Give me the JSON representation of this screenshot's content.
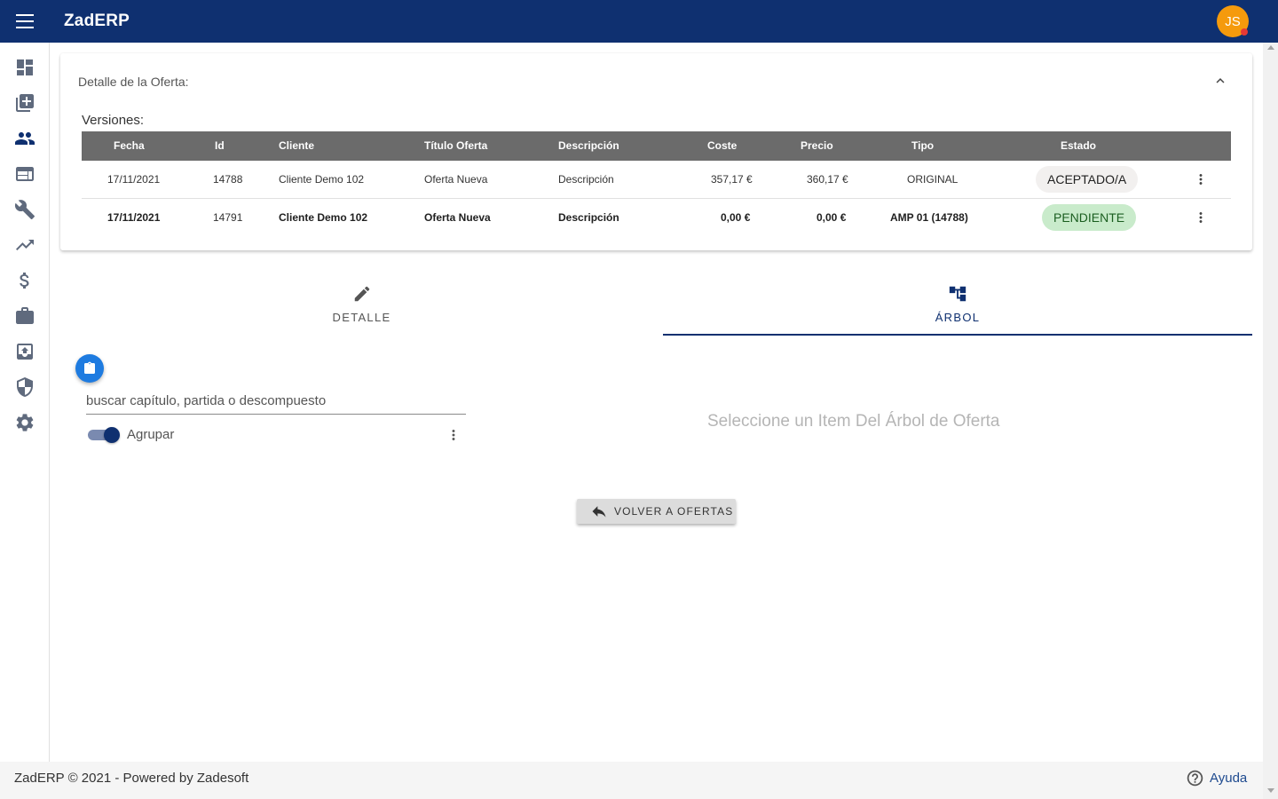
{
  "app": {
    "title": "ZadERP",
    "user_initials": "JS"
  },
  "sidebar": {
    "items": [
      {
        "name": "dashboard",
        "icon": "dashboard-icon"
      },
      {
        "name": "library",
        "icon": "library-icon"
      },
      {
        "name": "people",
        "icon": "people-icon"
      },
      {
        "name": "web",
        "icon": "web-window-icon"
      },
      {
        "name": "tools",
        "icon": "wrench-icon"
      },
      {
        "name": "trending",
        "icon": "trending-up-icon"
      },
      {
        "name": "money",
        "icon": "dollar-icon"
      },
      {
        "name": "work",
        "icon": "briefcase-icon"
      },
      {
        "name": "archive",
        "icon": "archive-icon"
      },
      {
        "name": "security",
        "icon": "shield-icon"
      },
      {
        "name": "settings",
        "icon": "gear-icon"
      }
    ]
  },
  "detail": {
    "title": "Detalle de la Oferta:",
    "versions_label": "Versiones:",
    "columns": [
      "Fecha",
      "Id",
      "Cliente",
      "Título Oferta",
      "Descripción",
      "Coste",
      "Precio",
      "Tipo",
      "Estado"
    ],
    "rows": [
      {
        "fecha": "17/11/2021",
        "id": "14788",
        "cliente": "Cliente Demo 102",
        "titulo": "Oferta Nueva",
        "descripcion": "Descripción",
        "coste": "357,17 €",
        "precio": "360,17 €",
        "tipo": "ORIGINAL",
        "estado": "ACEPTADO/A"
      },
      {
        "fecha": "17/11/2021",
        "id": "14791",
        "cliente": "Cliente Demo 102",
        "titulo": "Oferta Nueva",
        "descripcion": "Descripción",
        "coste": "0,00 €",
        "precio": "0,00 €",
        "tipo": "AMP 01 (14788)",
        "estado": "PENDIENTE"
      }
    ]
  },
  "tabs": [
    {
      "label": "DETALLE",
      "icon": "pencil-icon"
    },
    {
      "label": "ÁRBOL",
      "icon": "tree-icon",
      "active": true
    }
  ],
  "tree_panel": {
    "search_placeholder": "buscar capítulo, partida o descompuesto",
    "group_label": "Agrupar",
    "group_enabled": true
  },
  "empty_message": "Seleccione un Item Del Árbol de Oferta",
  "back_button": "VOLVER A OFERTAS",
  "footer": {
    "text": "ZadERP © 2021 - Powered by Zadesoft",
    "help_label": "Ayuda"
  },
  "colors": {
    "primary": "#0f3070",
    "accent": "#f59a0c",
    "fab": "#1e7be0",
    "pending_chip": "#c9ebcb",
    "accepted_chip": "#f2f0ef",
    "table_header": "#6b6b6b"
  }
}
